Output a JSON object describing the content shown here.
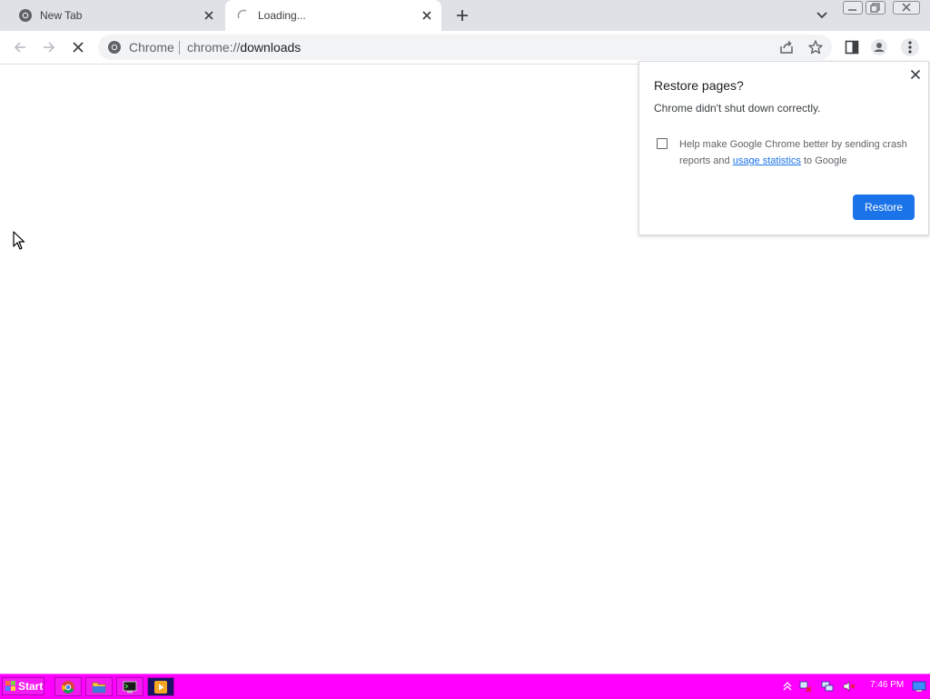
{
  "browser": {
    "tabs": [
      {
        "title": "New Tab",
        "state": "inactive",
        "icon": "chrome-icon"
      },
      {
        "title": "Loading...",
        "state": "active",
        "icon": "loading-spinner-icon"
      }
    ],
    "new_tab_icon": "plus-icon",
    "tab_search_icon": "chevron-down-icon"
  },
  "toolbar": {
    "back_icon": "arrow-left-icon",
    "forward_icon": "arrow-right-icon",
    "stop_icon": "close-icon",
    "omnibox": {
      "chip_label": "Chrome",
      "url_scheme": "chrome://",
      "url_host": "downloads"
    },
    "share_icon": "share-icon",
    "bookmark_icon": "star-icon",
    "side_panel_icon": "side-panel-icon",
    "profile_icon": "person-icon",
    "menu_icon": "more-vert-icon"
  },
  "restore_bubble": {
    "title": "Restore pages?",
    "message": "Chrome didn't shut down correctly.",
    "consent_text_before": "Help make Google Chrome better by sending crash reports and ",
    "consent_link": "usage statistics",
    "consent_text_after": " to Google",
    "checkbox_checked": false,
    "button_label": "Restore",
    "button_color": "#1a73e8"
  },
  "taskbar": {
    "start_label": "Start",
    "items": [
      "chrome-icon",
      "folder-icon",
      "terminal-icon",
      "media-player-icon"
    ],
    "tray_icons": [
      "tray-arrow-icon",
      "network-error-icon",
      "monitor-icon",
      "speaker-muted-icon"
    ],
    "clock": "7:46 PM",
    "background_color": "#ff00ff"
  }
}
